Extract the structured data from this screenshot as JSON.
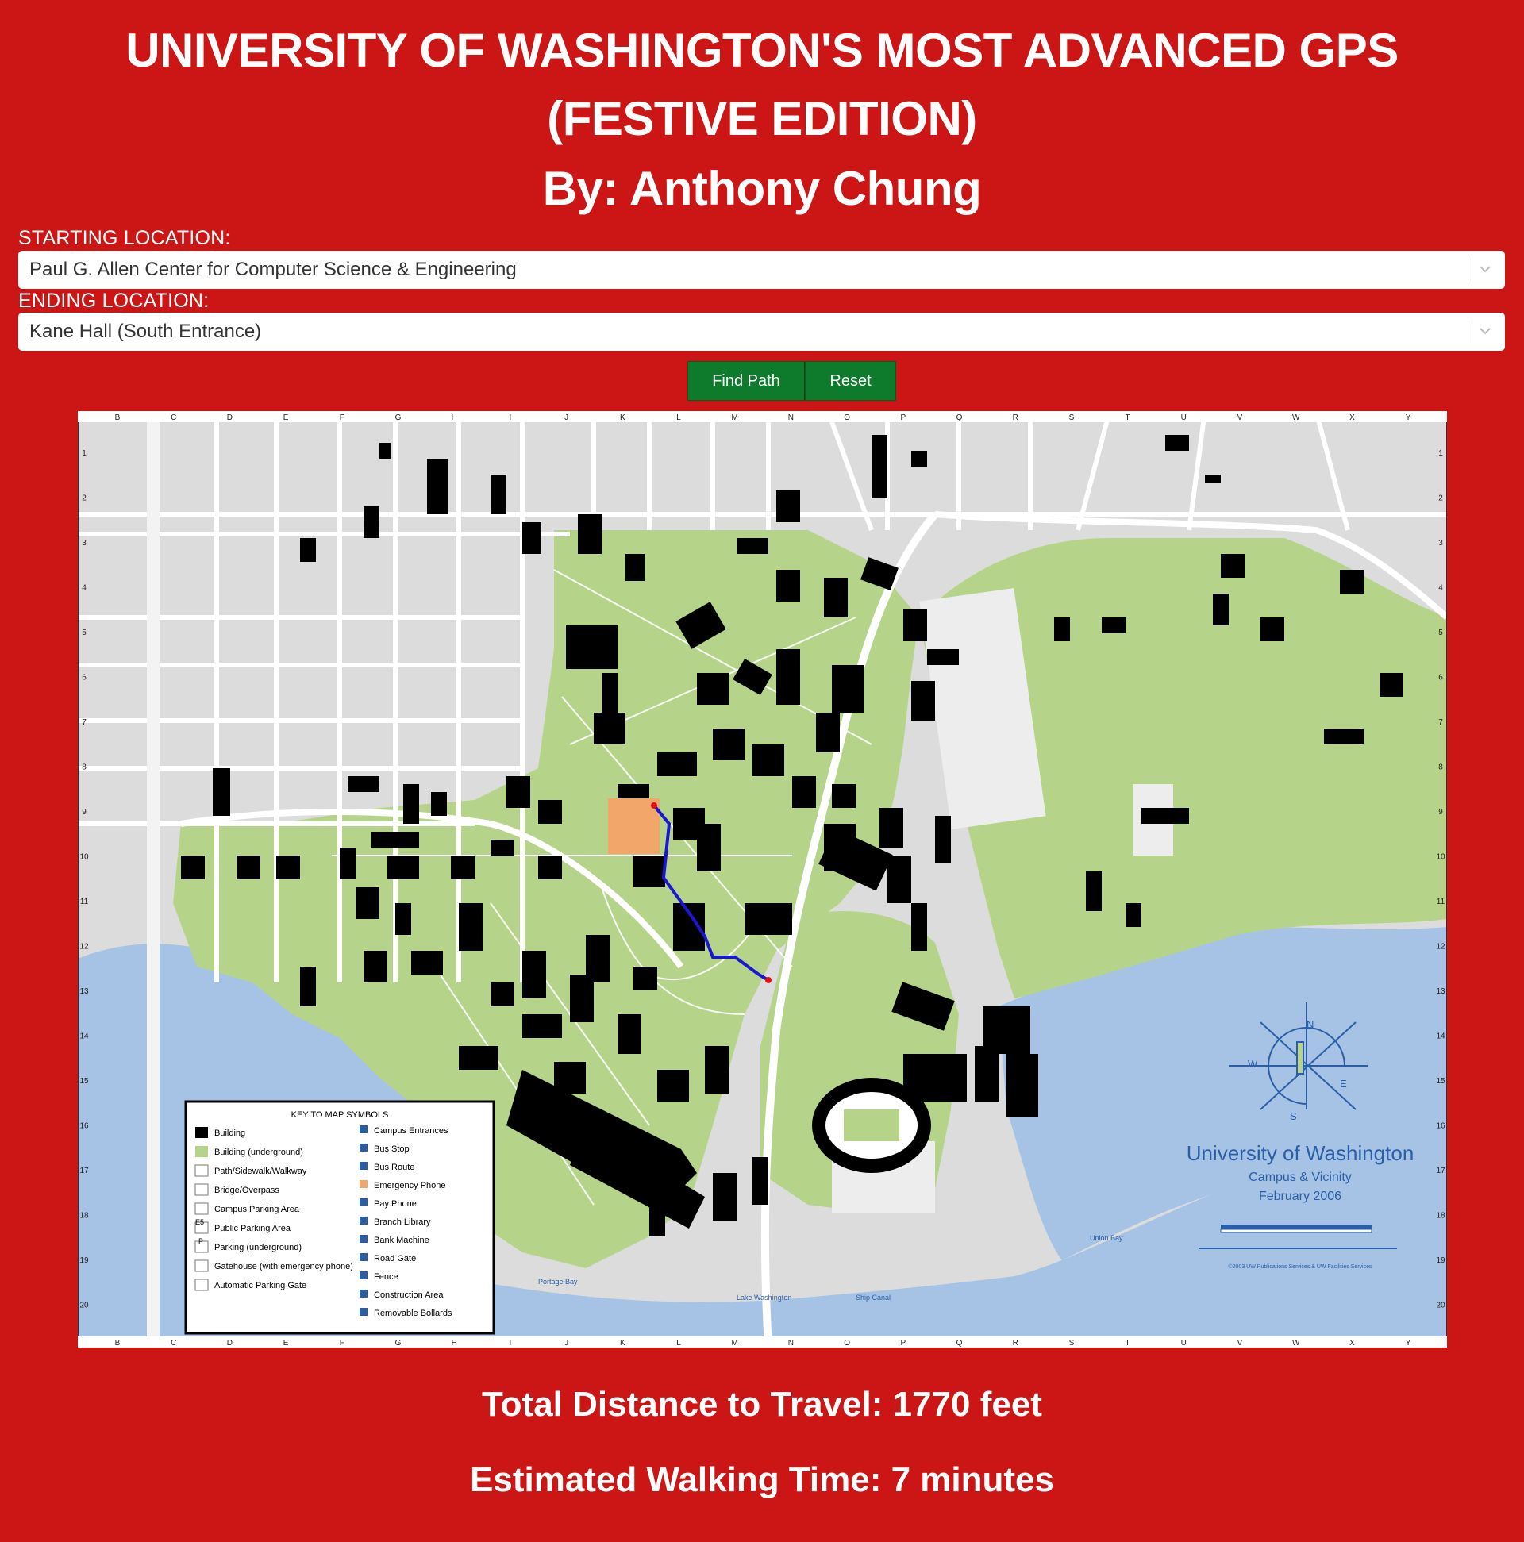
{
  "header": {
    "title_line1": "UNIVERSITY OF WASHINGTON'S MOST ADVANCED GPS",
    "title_line2": "(FESTIVE EDITION)",
    "byline": "By: Anthony Chung"
  },
  "form": {
    "start_label": "STARTING LOCATION:",
    "start_value": "Paul G. Allen Center for Computer Science & Engineering",
    "end_label": "ENDING LOCATION:",
    "end_value": "Kane Hall (South Entrance)",
    "find_button": "Find Path",
    "reset_button": "Reset"
  },
  "map": {
    "column_letters": [
      "B",
      "C",
      "D",
      "E",
      "F",
      "G",
      "H",
      "I",
      "J",
      "K",
      "L",
      "M",
      "N",
      "O",
      "P",
      "Q",
      "R",
      "S",
      "T",
      "U",
      "V",
      "W",
      "X",
      "Y"
    ],
    "row_numbers": [
      "1",
      "2",
      "3",
      "4",
      "5",
      "6",
      "7",
      "8",
      "9",
      "10",
      "11",
      "12",
      "13",
      "14",
      "15",
      "16",
      "17",
      "18",
      "19",
      "20"
    ],
    "legend": {
      "title": "KEY TO MAP SYMBOLS",
      "left_items": [
        "Building",
        "Building (underground)",
        "Path/Sidewalk/Walkway",
        "Bridge/Overpass",
        "Campus Parking Area",
        "Public Parking Area",
        "Parking (underground)",
        "Gatehouse (with emergency phone)",
        "Automatic Parking Gate"
      ],
      "right_items": [
        "Campus Entrances",
        "Bus Stop",
        "Bus Route",
        "Emergency Phone",
        "Pay Phone",
        "Branch Library",
        "Bank Machine",
        "Road Gate",
        "Fence",
        "Construction Area",
        "Removable Bollards"
      ],
      "e5_code": "E5",
      "p_code": "P"
    },
    "branding": {
      "name": "University of Washington",
      "subtitle": "Campus & Vicinity",
      "date": "February 2006",
      "credit": "©2003 UW Publications Services & UW Facilities Services",
      "compass_n": "N",
      "compass_e": "E",
      "compass_s": "S",
      "compass_w": "W"
    },
    "water_labels": {
      "portage": "Portage Bay",
      "lake": "Lake Washington",
      "union": "Union Bay",
      "ship": "Ship Canal"
    },
    "colors": {
      "campus_green": "#b5d48a",
      "water_blue": "#a6c3e6",
      "building": "#000000",
      "route": "#1a16d6",
      "start_dot": "#e0101a",
      "highlight": "#f2a66a"
    }
  },
  "results": {
    "distance": "Total Distance to Travel: 1770 feet",
    "time": "Estimated Walking Time: 7 minutes"
  }
}
